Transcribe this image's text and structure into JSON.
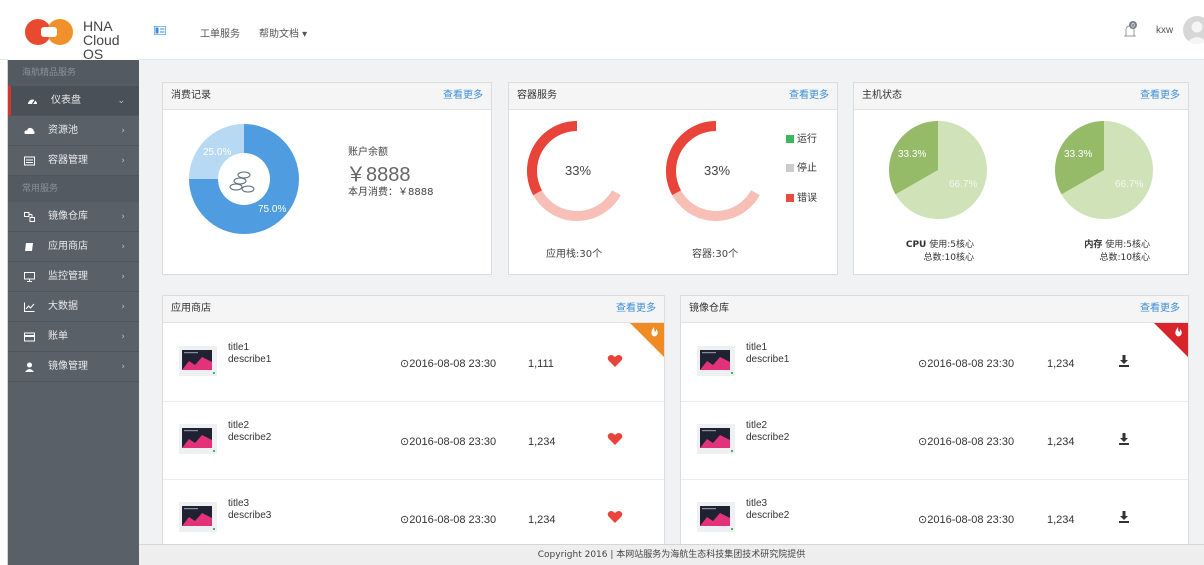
{
  "header": {
    "logo_line1": "HNA",
    "logo_line2": "Cloud OS",
    "nav": [
      "工单服务",
      "帮助文档 ▾"
    ],
    "notification_count": "0",
    "user": "kxw"
  },
  "sidebar": {
    "sections": [
      {
        "title": "海航精品服务",
        "items": [
          {
            "label": "仪表盘",
            "icon": "dashboard-icon",
            "active": true
          },
          {
            "label": "资源池",
            "icon": "cloud-icon"
          },
          {
            "label": "容器管理",
            "icon": "container-icon"
          }
        ]
      },
      {
        "title": "常用服务",
        "items": [
          {
            "label": "镜像仓库",
            "icon": "mirror-icon"
          },
          {
            "label": "应用商店",
            "icon": "store-icon"
          },
          {
            "label": "监控管理",
            "icon": "monitor-icon"
          },
          {
            "label": "大数据",
            "icon": "chart-line-icon"
          },
          {
            "label": "账单",
            "icon": "bill-icon"
          },
          {
            "label": "镜像管理",
            "icon": "user-icon"
          }
        ]
      }
    ]
  },
  "cards": {
    "consumption": {
      "title": "消费记录",
      "more": "查看更多",
      "balance_label": "账户余额",
      "balance": "￥8888",
      "month_spend": "本月消费：￥8888",
      "pie": [
        {
          "label": "25.0%",
          "value": 25,
          "color": "#b7d9f3"
        },
        {
          "label": "75.0%",
          "value": 75,
          "color": "#4f9de0"
        }
      ]
    },
    "containers": {
      "title": "容器服务",
      "more": "查看更多",
      "ring1_pct": "33%",
      "ring2_pct": "33%",
      "ring_values": {
        "error": 33,
        "rest": 67
      },
      "legend": [
        {
          "label": "运行",
          "color": "#3cb85c"
        },
        {
          "label": "停止",
          "color": "#cccccc"
        },
        {
          "label": "错误",
          "color": "#e84c3d"
        }
      ],
      "caption1": "应用栈:30个",
      "caption2": "容器:30个",
      "colors": {
        "error": "#e8443a",
        "rest": "#f7bfb5"
      }
    },
    "host": {
      "title": "主机状态",
      "more": "查看更多",
      "pie_labels": [
        "33.3%",
        "66.7%"
      ],
      "pie_values": [
        33.3,
        66.7
      ],
      "colors": {
        "dark": "#95bb68",
        "light": "#cfe2b8"
      },
      "cpu_name": "CPU",
      "cpu_used": "使用:5核心",
      "cpu_total": "总数:10核心",
      "mem_name": "内存",
      "mem_used": "使用:5核心",
      "mem_total": "总数:10核心"
    },
    "app_store": {
      "title": "应用商店",
      "more": "查看更多",
      "rows": [
        {
          "title": "title1",
          "desc": "describe1",
          "time": "⊙2016-08-08 23:30",
          "count": "1,111"
        },
        {
          "title": "title2",
          "desc": "describe2",
          "time": "⊙2016-08-08 23:30",
          "count": "1,234"
        },
        {
          "title": "title3",
          "desc": "describe3",
          "time": "⊙2016-08-08 23:30",
          "count": "1,234"
        }
      ]
    },
    "mirror_repo": {
      "title": "镜像仓库",
      "more": "查看更多",
      "rows": [
        {
          "title": "title1",
          "desc": "describe1",
          "time": "⊙2016-08-08 23:30",
          "count": "1,234"
        },
        {
          "title": "title2",
          "desc": "describe2",
          "time": "⊙2016-08-08 23:30",
          "count": "1,234"
        },
        {
          "title": "title3",
          "desc": "describe2",
          "time": "⊙2016-08-08 23:30",
          "count": "1,234"
        }
      ]
    }
  },
  "footer": "Copyright 2016 | 本网站服务为海航生态科技集团技术研究院提供",
  "colors": {
    "accent": "#3b8ed8",
    "heart": "#e8443a",
    "ribbon_orange": "#f08a24",
    "ribbon_red": "#d9242b"
  }
}
